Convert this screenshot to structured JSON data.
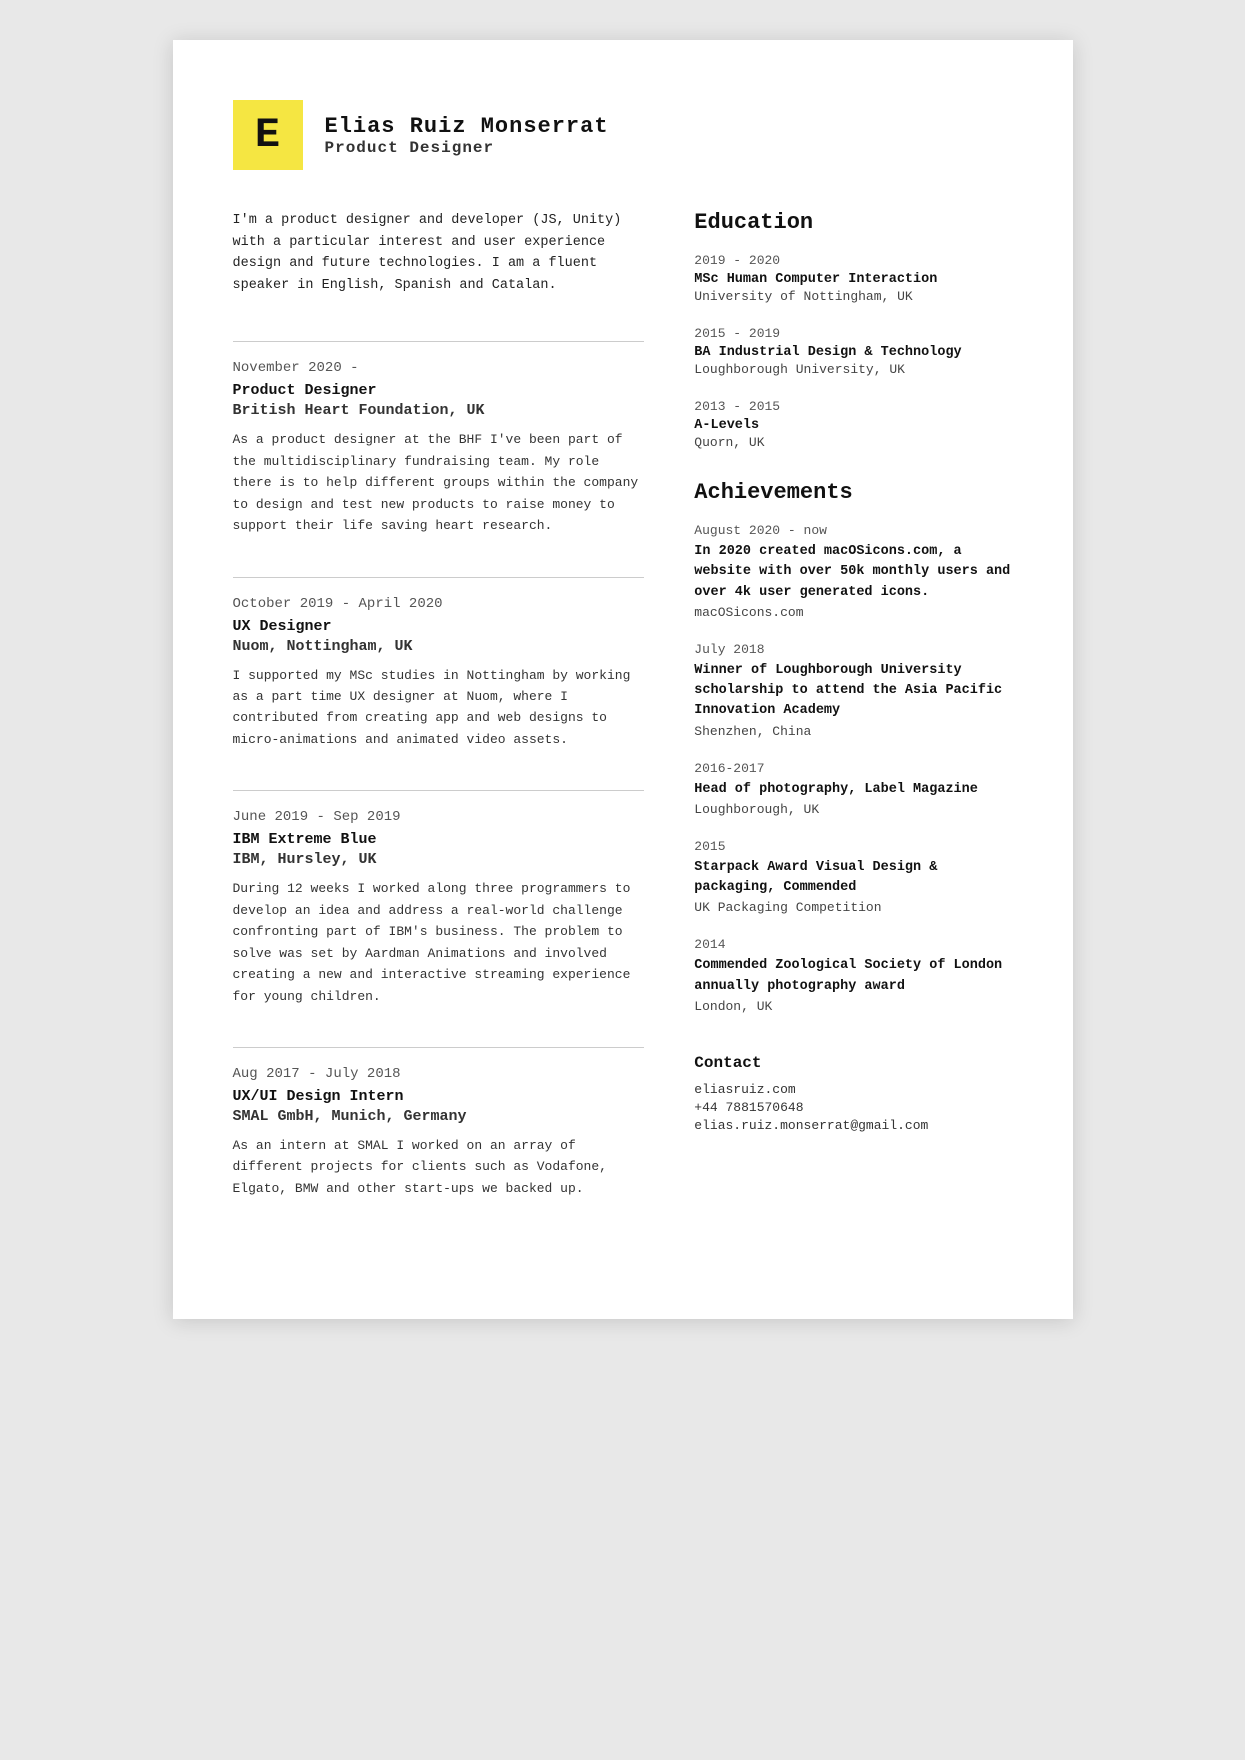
{
  "header": {
    "initial": "E",
    "name": "Elias Ruiz Monserrat",
    "title": "Product Designer"
  },
  "bio": "I'm a product designer and  developer (JS, Unity) with a particular interest and user experience design and future technologies. I am a fluent speaker in English, Spanish and Catalan.",
  "experience": [
    {
      "date": "November 2020 -",
      "role": "Product Designer",
      "company": "British Heart Foundation, UK",
      "description": "As a product designer at the BHF I've been part of the multidisciplinary fundraising team. My role there is to help different groups within the company to design and test new products to raise money to support their life saving heart research."
    },
    {
      "date": "October 2019 - April 2020",
      "role": "UX Designer",
      "company": "Nuom, Nottingham, UK",
      "description": "I supported my MSc studies in Nottingham by working as a part time UX designer at Nuom, where I contributed from creating app and web designs to micro-animations and animated video assets."
    },
    {
      "date": "June 2019 - Sep 2019",
      "role": "IBM Extreme Blue",
      "company": "IBM, Hursley, UK",
      "description": "During 12 weeks I worked along three programmers to develop an idea and address a real-world challenge confronting part of IBM's business. The problem to solve was set by Aardman Animations and involved creating a new and interactive streaming experience for young children."
    },
    {
      "date": "Aug 2017 - July 2018",
      "role": "UX/UI Design Intern",
      "company": "SMAL GmbH, Munich, Germany",
      "description": "As an intern at SMAL I worked on an array of different projects for clients such as Vodafone, Elgato, BMW and other start-ups we backed up."
    }
  ],
  "education": {
    "section_title": "Education",
    "items": [
      {
        "years": "2019 - 2020",
        "degree": "MSc Human Computer Interaction",
        "school": "University of Nottingham, UK"
      },
      {
        "years": "2015 - 2019",
        "degree": "BA Industrial Design & Technology",
        "school": "Loughborough University, UK"
      },
      {
        "years": "2013 - 2015",
        "degree": "A-Levels",
        "school": "Quorn, UK"
      }
    ]
  },
  "achievements": {
    "section_title": "Achievements",
    "items": [
      {
        "date": "August 2020 - now",
        "title": "In 2020 created macOSicons.com, a website with over 50k monthly users and over 4k user generated icons.",
        "sub": "macOSicons.com"
      },
      {
        "date": "July 2018",
        "title": "Winner of Loughborough University scholarship to attend the Asia Pacific Innovation Academy",
        "sub": "Shenzhen, China"
      },
      {
        "date": "2016-2017",
        "title": "Head of photography, Label Magazine",
        "sub": "Loughborough, UK"
      },
      {
        "date": "2015",
        "title": "Starpack Award Visual Design & packaging, Commended",
        "sub": "UK Packaging Competition"
      },
      {
        "date": "2014",
        "title": "Commended Zoological Society of London annually photography award",
        "sub": "London, UK"
      }
    ]
  },
  "contact": {
    "title": "Contact",
    "items": [
      "eliasruiz.com",
      "+44 7881570648",
      "elias.ruiz.monserrat@gmail.com"
    ]
  }
}
